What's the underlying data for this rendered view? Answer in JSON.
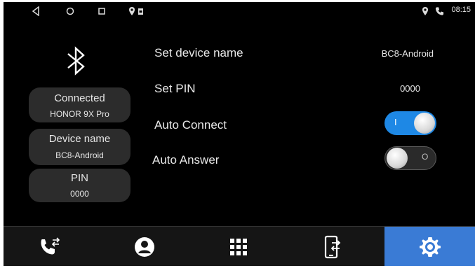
{
  "status_bar": {
    "left_icons": [
      "back-icon",
      "home-icon",
      "recents-icon",
      "location-icon",
      "sim-card-icon"
    ],
    "right_icons": [
      "location-icon",
      "phone-icon"
    ],
    "time": "08:15"
  },
  "left_panel": {
    "bluetooth_icon": "bluetooth-icon",
    "connected": {
      "label": "Connected",
      "value": "HONOR 9X Pro"
    },
    "device_name": {
      "label": "Device name",
      "value": "BC8-Android"
    },
    "pin": {
      "label": "PIN",
      "value": "0000"
    }
  },
  "settings": {
    "set_device_name": {
      "label": "Set device name",
      "value": "BC8-Android"
    },
    "set_pin": {
      "label": "Set PIN",
      "value": "0000"
    },
    "auto_connect": {
      "label": "Auto Connect",
      "state": "on",
      "on_mark": "I"
    },
    "auto_answer": {
      "label": "Auto Answer",
      "state": "off",
      "off_mark": "O"
    }
  },
  "navbar": {
    "items": [
      {
        "icon": "call-transfer-icon",
        "active": false
      },
      {
        "icon": "contacts-icon",
        "active": false
      },
      {
        "icon": "dialpad-icon",
        "active": false
      },
      {
        "icon": "phone-transfer-icon",
        "active": false
      },
      {
        "icon": "settings-gear-icon",
        "active": true
      }
    ]
  },
  "colors": {
    "background": "#000000",
    "accent": "#3a7bd5",
    "toggle_on": "#1e88e5",
    "pill_bg": "#2c2c2c"
  }
}
